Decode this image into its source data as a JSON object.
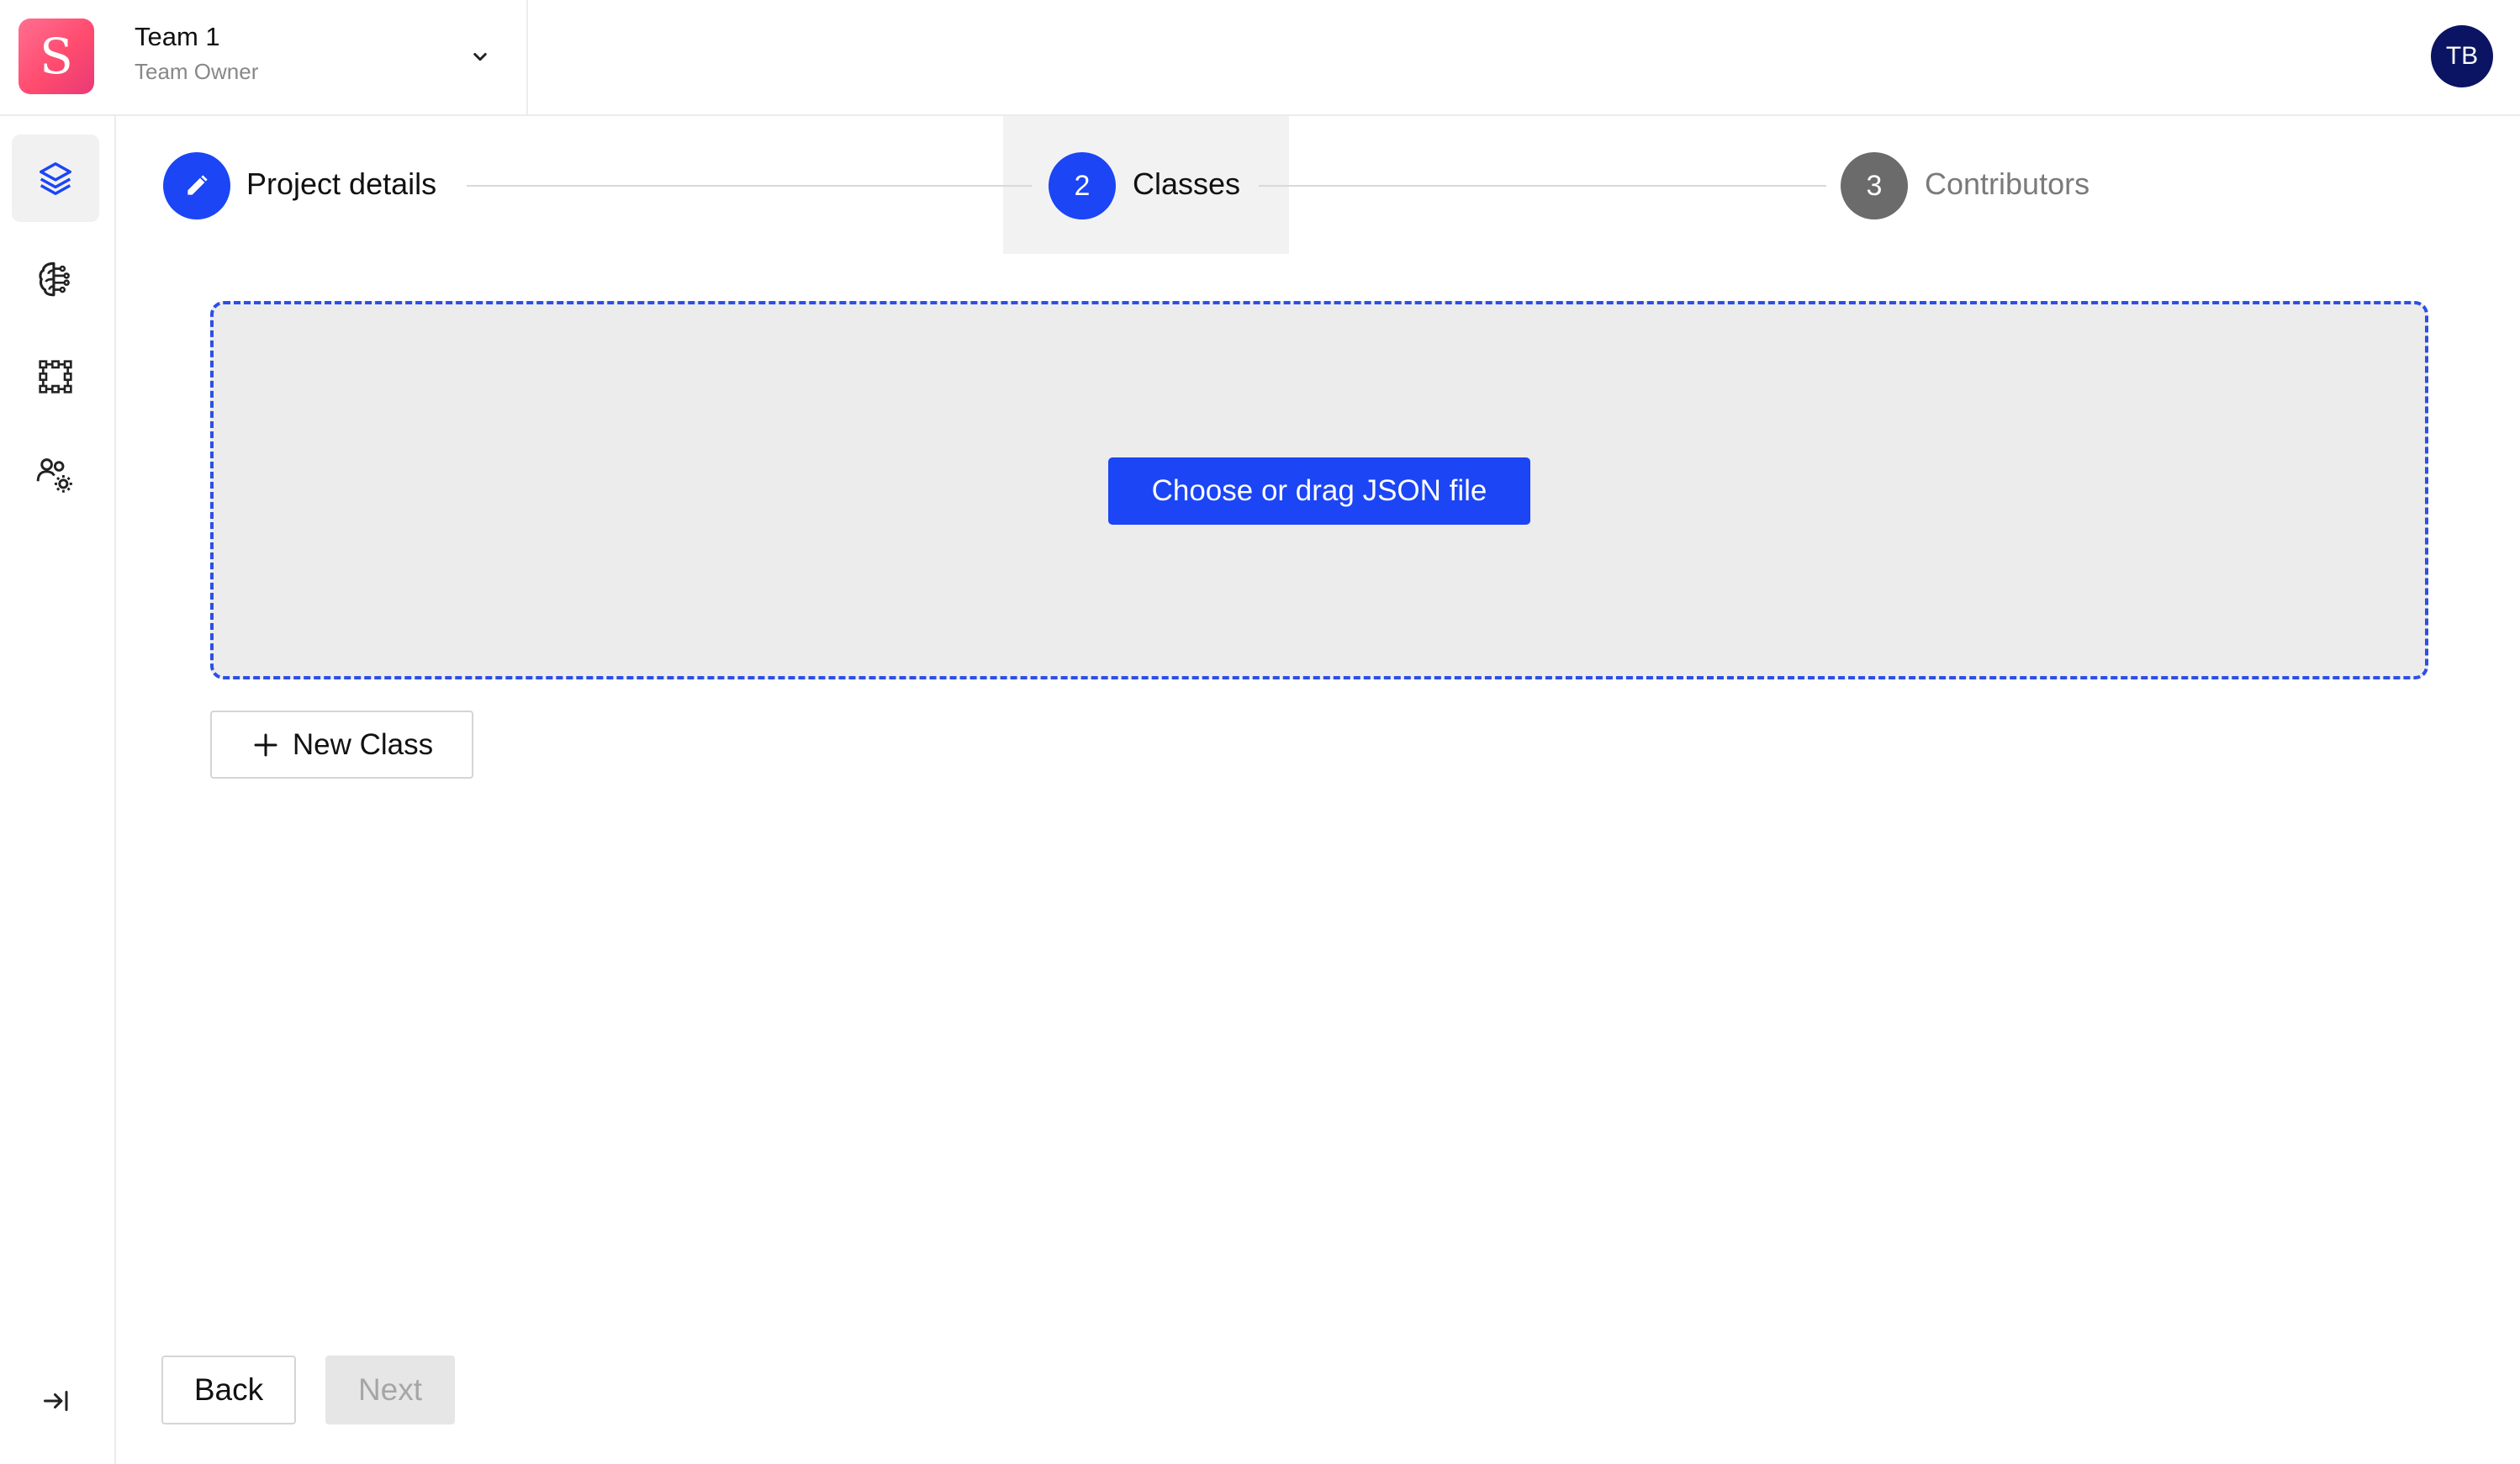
{
  "header": {
    "team_name": "Team 1",
    "team_role": "Team Owner",
    "logo_letter": "S",
    "user_initials": "TB"
  },
  "sidebar": {
    "items": [
      {
        "name": "projects",
        "icon": "layers-icon",
        "active": true
      },
      {
        "name": "models",
        "icon": "brain-icon",
        "active": false
      },
      {
        "name": "datasets",
        "icon": "nodes-grid-icon",
        "active": false
      },
      {
        "name": "team-settings",
        "icon": "users-gear-icon",
        "active": false
      }
    ],
    "collapse_icon": "collapse-right-icon"
  },
  "stepper": {
    "steps": [
      {
        "number": "",
        "label": "Project details",
        "state": "completed",
        "icon": "pencil-icon"
      },
      {
        "number": "2",
        "label": "Classes",
        "state": "active"
      },
      {
        "number": "3",
        "label": "Contributors",
        "state": "pending"
      }
    ]
  },
  "classes": {
    "upload_button": "Choose or drag JSON file",
    "new_class_button": "New Class"
  },
  "footer": {
    "back_label": "Back",
    "next_label": "Next"
  },
  "colors": {
    "accent": "#1b45f5",
    "logo_gradient_start": "#ff6f91",
    "logo_gradient_end": "#e83a78",
    "avatar_bg": "#0b1463",
    "pending_step": "#6b6b6b"
  }
}
